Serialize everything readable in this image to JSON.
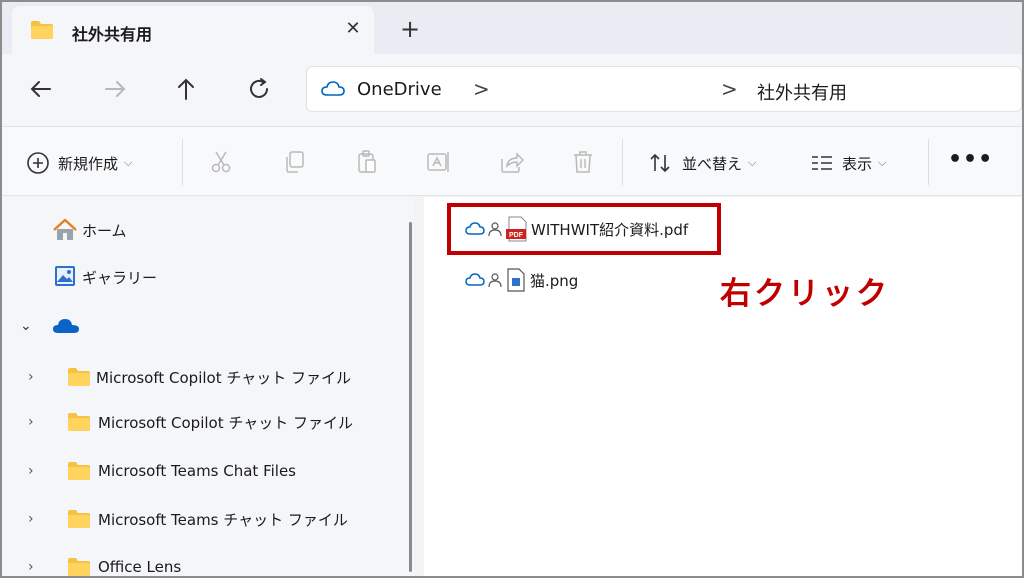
{
  "tab": {
    "title": "社外共有用",
    "close": "✕",
    "new_tab": "+"
  },
  "address": {
    "root": "OneDrive",
    "sep": ">",
    "current": "社外共有用"
  },
  "toolbar": {
    "new_label": "新規作成",
    "sort_label": "並べ替え",
    "view_label": "表示",
    "more": "•••"
  },
  "sidebar": {
    "items": [
      {
        "label": "ホーム",
        "icon": "home-icon"
      },
      {
        "label": "ギャラリー",
        "icon": "gallery-icon"
      },
      {
        "label": "",
        "icon": "onedrive-cloud-icon"
      },
      {
        "label": "Microsoft Copilot チャット ファイル",
        "icon": "folder-icon"
      },
      {
        "label": "Microsoft Copilot チャット ファイル",
        "icon": "folder-icon"
      },
      {
        "label": "Microsoft Teams Chat Files",
        "icon": "folder-icon"
      },
      {
        "label": "Microsoft Teams チャット ファイル",
        "icon": "folder-icon"
      },
      {
        "label": "Office Lens",
        "icon": "folder-icon"
      }
    ]
  },
  "files": [
    {
      "name": "WITHWIT紹介資料.pdf",
      "icon": "pdf-icon",
      "highlighted": true
    },
    {
      "name": "猫.png",
      "icon": "image-file-icon",
      "highlighted": false
    }
  ],
  "annotation": {
    "text": "右クリック",
    "color": "#c00000"
  },
  "colors": {
    "accent": "#0067c0",
    "folder": "#f5c242",
    "highlight": "#c00000"
  }
}
